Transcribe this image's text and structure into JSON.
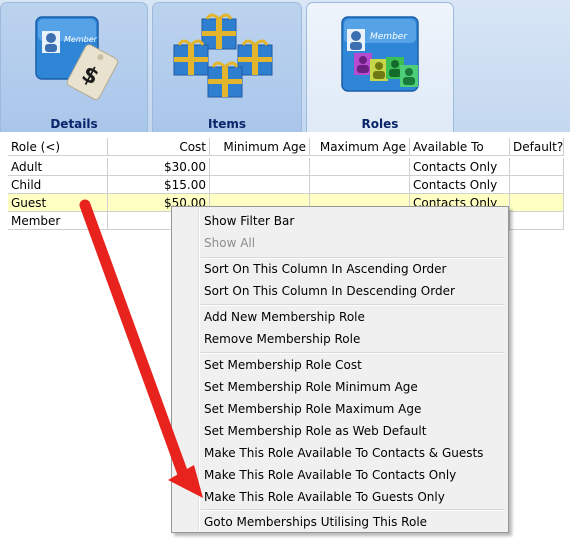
{
  "tabs": [
    {
      "label": "Details",
      "icon": "member-card-icon",
      "card_text": "Member"
    },
    {
      "label": "Items",
      "icon": "gift-boxes-icon"
    },
    {
      "label": "Roles",
      "icon": "member-roles-icon",
      "card_text": "Member"
    }
  ],
  "grid": {
    "columns": [
      "Role (<)",
      "Cost",
      "Minimum Age",
      "Maximum Age",
      "Available To",
      "Default?"
    ],
    "rows": [
      {
        "role": "Adult",
        "cost": "$30.00",
        "min_age": "",
        "max_age": "",
        "available_to": "Contacts Only",
        "default": ""
      },
      {
        "role": "Child",
        "cost": "$15.00",
        "min_age": "",
        "max_age": "",
        "available_to": "Contacts Only",
        "default": ""
      },
      {
        "role": "Guest",
        "cost": "$50.00",
        "min_age": "",
        "max_age": "",
        "available_to": "Contacts Only",
        "default": ""
      },
      {
        "role": "Member",
        "cost": "",
        "min_age": "",
        "max_age": "",
        "available_to": "",
        "default": ""
      }
    ]
  },
  "context_menu": {
    "items": [
      {
        "label": "Show Filter Bar",
        "enabled": true
      },
      {
        "label": "Show All",
        "enabled": false
      },
      {
        "label": "Sort On This Column In Ascending Order",
        "enabled": true
      },
      {
        "label": "Sort On This Column In Descending Order",
        "enabled": true
      },
      {
        "label": "Add New Membership Role",
        "enabled": true
      },
      {
        "label": "Remove Membership Role",
        "enabled": true
      },
      {
        "label": "Set Membership Role Cost",
        "enabled": true
      },
      {
        "label": "Set Membership Role Minimum Age",
        "enabled": true
      },
      {
        "label": "Set Membership Role Maximum Age",
        "enabled": true
      },
      {
        "label": "Set Membership Role as Web Default",
        "enabled": true
      },
      {
        "label": "Make This Role Available To Contacts & Guests",
        "enabled": true
      },
      {
        "label": "Make This Role Available To Contacts Only",
        "enabled": true
      },
      {
        "label": "Make This Role Available To Guests Only",
        "enabled": true
      },
      {
        "label": "Goto Memberships Utilising This Role",
        "enabled": true
      }
    ]
  },
  "colors": {
    "selected_row": "#ffffc4",
    "annotation_arrow": "#e8221c",
    "tab_label": "#0a246a"
  }
}
